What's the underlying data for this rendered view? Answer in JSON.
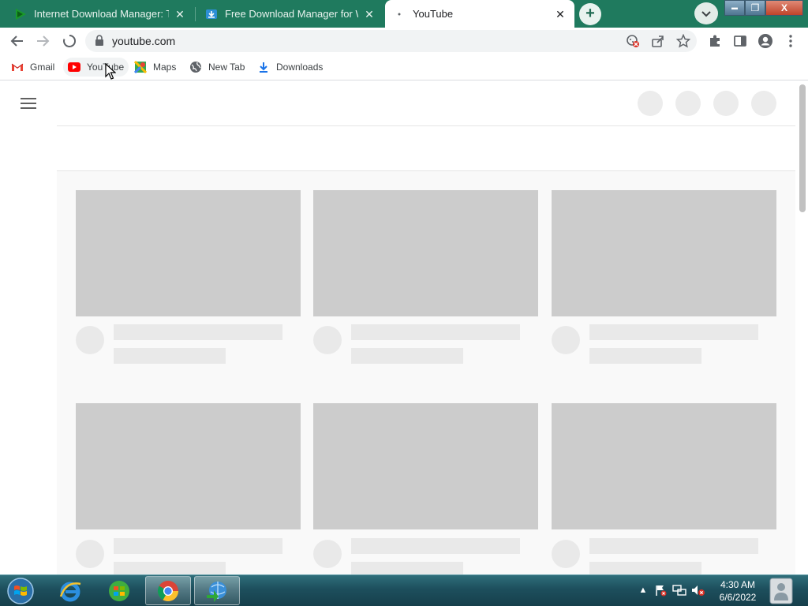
{
  "tabs": [
    {
      "title": "Internet Download Manager: The",
      "favicon": "idm-play-icon",
      "active": false
    },
    {
      "title": "Free Download Manager for Win",
      "favicon": "fdm-icon",
      "active": false
    },
    {
      "title": "YouTube",
      "favicon": "loading-dot-icon",
      "active": true
    }
  ],
  "tab_close_glyph": "✕",
  "newtab_glyph": "+",
  "window": {
    "minimize": "▬",
    "maximize": "❐",
    "close": "X"
  },
  "toolbar": {
    "url": "youtube.com"
  },
  "bookmarks": [
    {
      "label": "Gmail",
      "icon": "gmail-icon"
    },
    {
      "label": "YouTube",
      "icon": "youtube-icon"
    },
    {
      "label": "Maps",
      "icon": "maps-icon"
    },
    {
      "label": "New Tab",
      "icon": "globe-icon"
    },
    {
      "label": "Downloads",
      "icon": "download-icon"
    }
  ],
  "taskbar": {
    "time": "4:30 AM",
    "date": "6/6/2022",
    "apps": [
      "internet-explorer",
      "windows-media-center",
      "chrome",
      "internet-download-manager"
    ]
  },
  "colors": {
    "tabstrip": "#1f7a5e",
    "placeholder_thumb": "#cccccc",
    "placeholder_line": "#e9e9e9"
  }
}
